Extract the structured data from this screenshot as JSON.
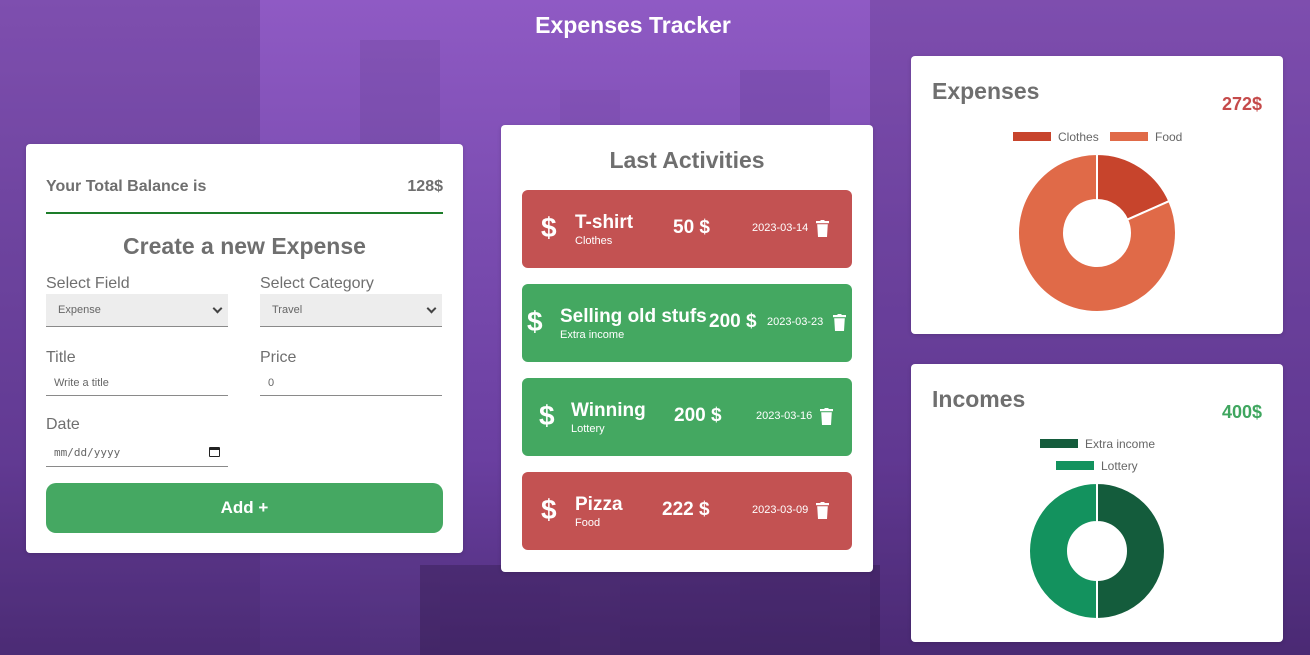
{
  "app": {
    "title": "Expenses Tracker"
  },
  "form": {
    "balance_label": "Your Total Balance is",
    "balance_value": "128$",
    "title": "Create a new Expense",
    "field_label": "Select Field",
    "field_value": "Expense",
    "category_label": "Select Category",
    "category_value": "Travel",
    "title_label": "Title",
    "title_placeholder": "Write a title",
    "price_label": "Price",
    "price_placeholder": "0",
    "date_label": "Date",
    "date_placeholder": "mm/dd/yyyy",
    "add_button": "Add +"
  },
  "activities": {
    "title": "Last Activities",
    "items": [
      {
        "name": "T-shirt",
        "category": "Clothes",
        "amount": "50 $",
        "date": "2023-03-14",
        "type": "expense"
      },
      {
        "name": "Selling old stufs",
        "category": "Extra income",
        "amount": "200 $",
        "date": "2023-03-23",
        "type": "income"
      },
      {
        "name": "Winning",
        "category": "Lottery",
        "amount": "200 $",
        "date": "2023-03-16",
        "type": "income"
      },
      {
        "name": "Pizza",
        "category": "Food",
        "amount": "222 $",
        "date": "2023-03-09",
        "type": "expense"
      }
    ]
  },
  "colors": {
    "expense": "#c35252",
    "income": "#44a861",
    "balance_line": "#1d7d2a",
    "clothes": "#c7442c",
    "food": "#e06a48",
    "extra_income": "#145c3c",
    "lottery": "#13925e"
  },
  "expenses_chart": {
    "title": "Expenses",
    "total": "272$"
  },
  "incomes_chart": {
    "title": "Incomes",
    "total": "400$"
  },
  "chart_data": [
    {
      "type": "pie",
      "title": "Expenses",
      "categories": [
        "Clothes",
        "Food"
      ],
      "values": [
        50,
        222
      ],
      "colors": [
        "#c7442c",
        "#e06a48"
      ],
      "legend": "top"
    },
    {
      "type": "pie",
      "title": "Incomes",
      "categories": [
        "Extra income",
        "Lottery"
      ],
      "values": [
        200,
        200
      ],
      "colors": [
        "#145c3c",
        "#13925e"
      ],
      "legend": "top"
    }
  ]
}
